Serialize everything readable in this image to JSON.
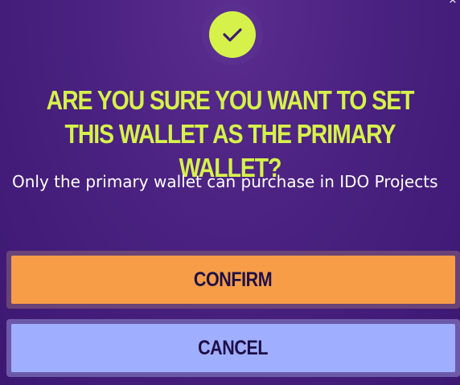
{
  "dialog": {
    "close_glyph": "×",
    "icon": "check-icon",
    "title": "ARE YOU SURE YOU WANT TO SET THIS WALLET AS THE PRIMARY WALLET?",
    "message": "Only the primary wallet can purchase in IDO Projects",
    "confirm_label": "CONFIRM",
    "cancel_label": "CANCEL"
  },
  "colors": {
    "background": "#4a2180",
    "accent": "#d6f24a",
    "confirm": "#f79d47",
    "cancel": "#a0aeff",
    "button_text": "#1e0f47"
  }
}
